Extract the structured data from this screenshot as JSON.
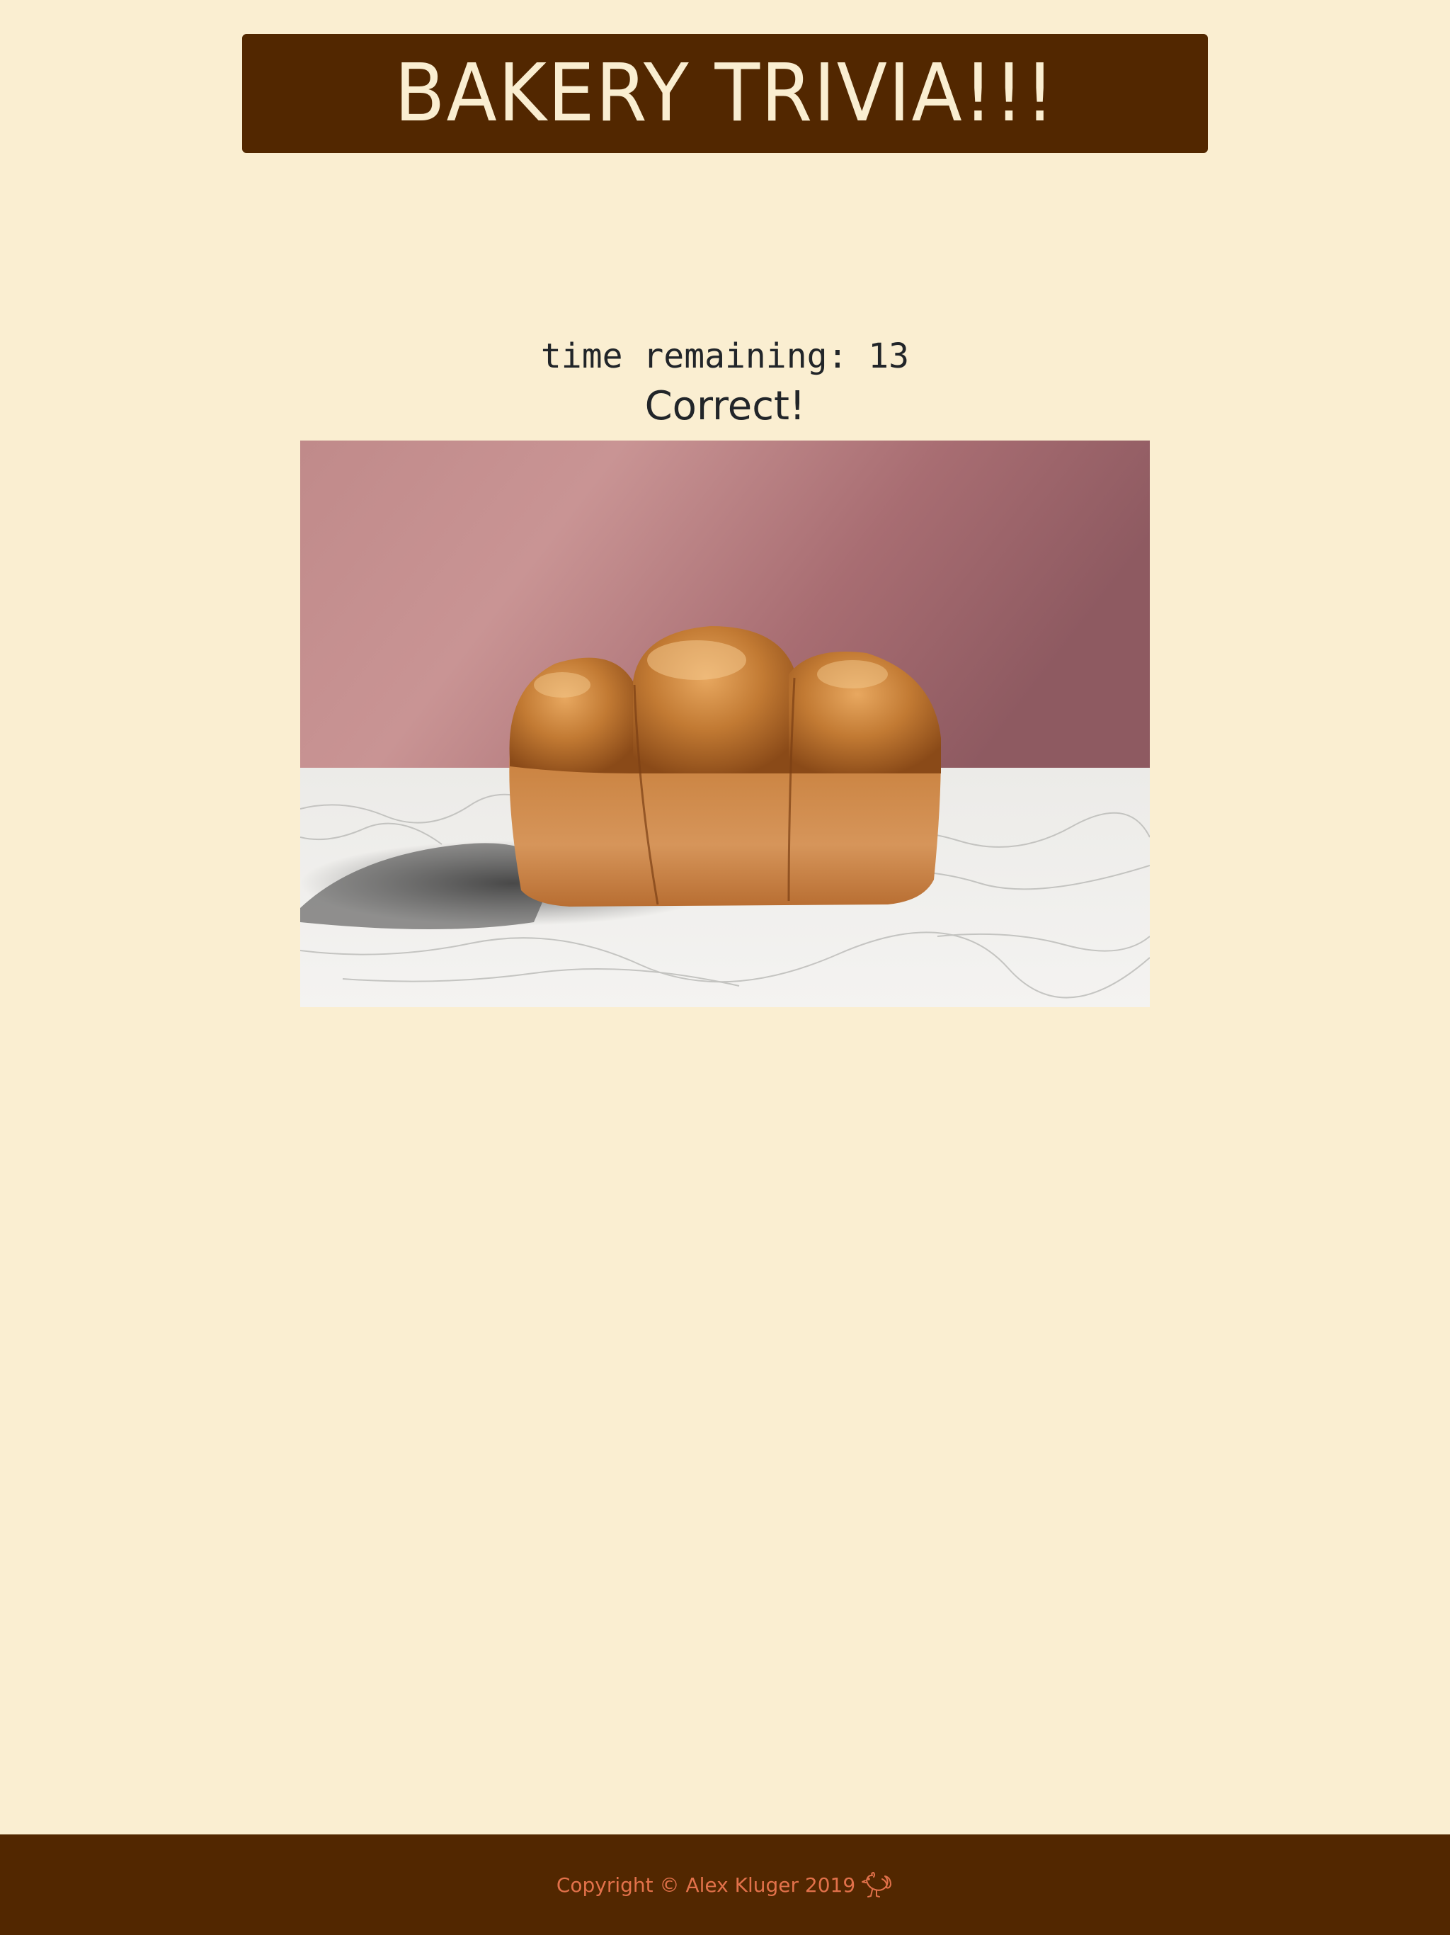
{
  "header": {
    "title": "BAKERY TRIVIA!!!"
  },
  "game": {
    "timer_text": "time remaining: 13",
    "result_text": "Correct!",
    "image_subject": "brioche-loaf-photo"
  },
  "footer": {
    "copyright_text": "Copyright © Alex Kluger 2019",
    "icon": "rooster-icon"
  },
  "colors": {
    "background": "#faeed1",
    "brand_brown": "#522700",
    "footer_text": "#e2714a",
    "body_text": "#212529"
  }
}
